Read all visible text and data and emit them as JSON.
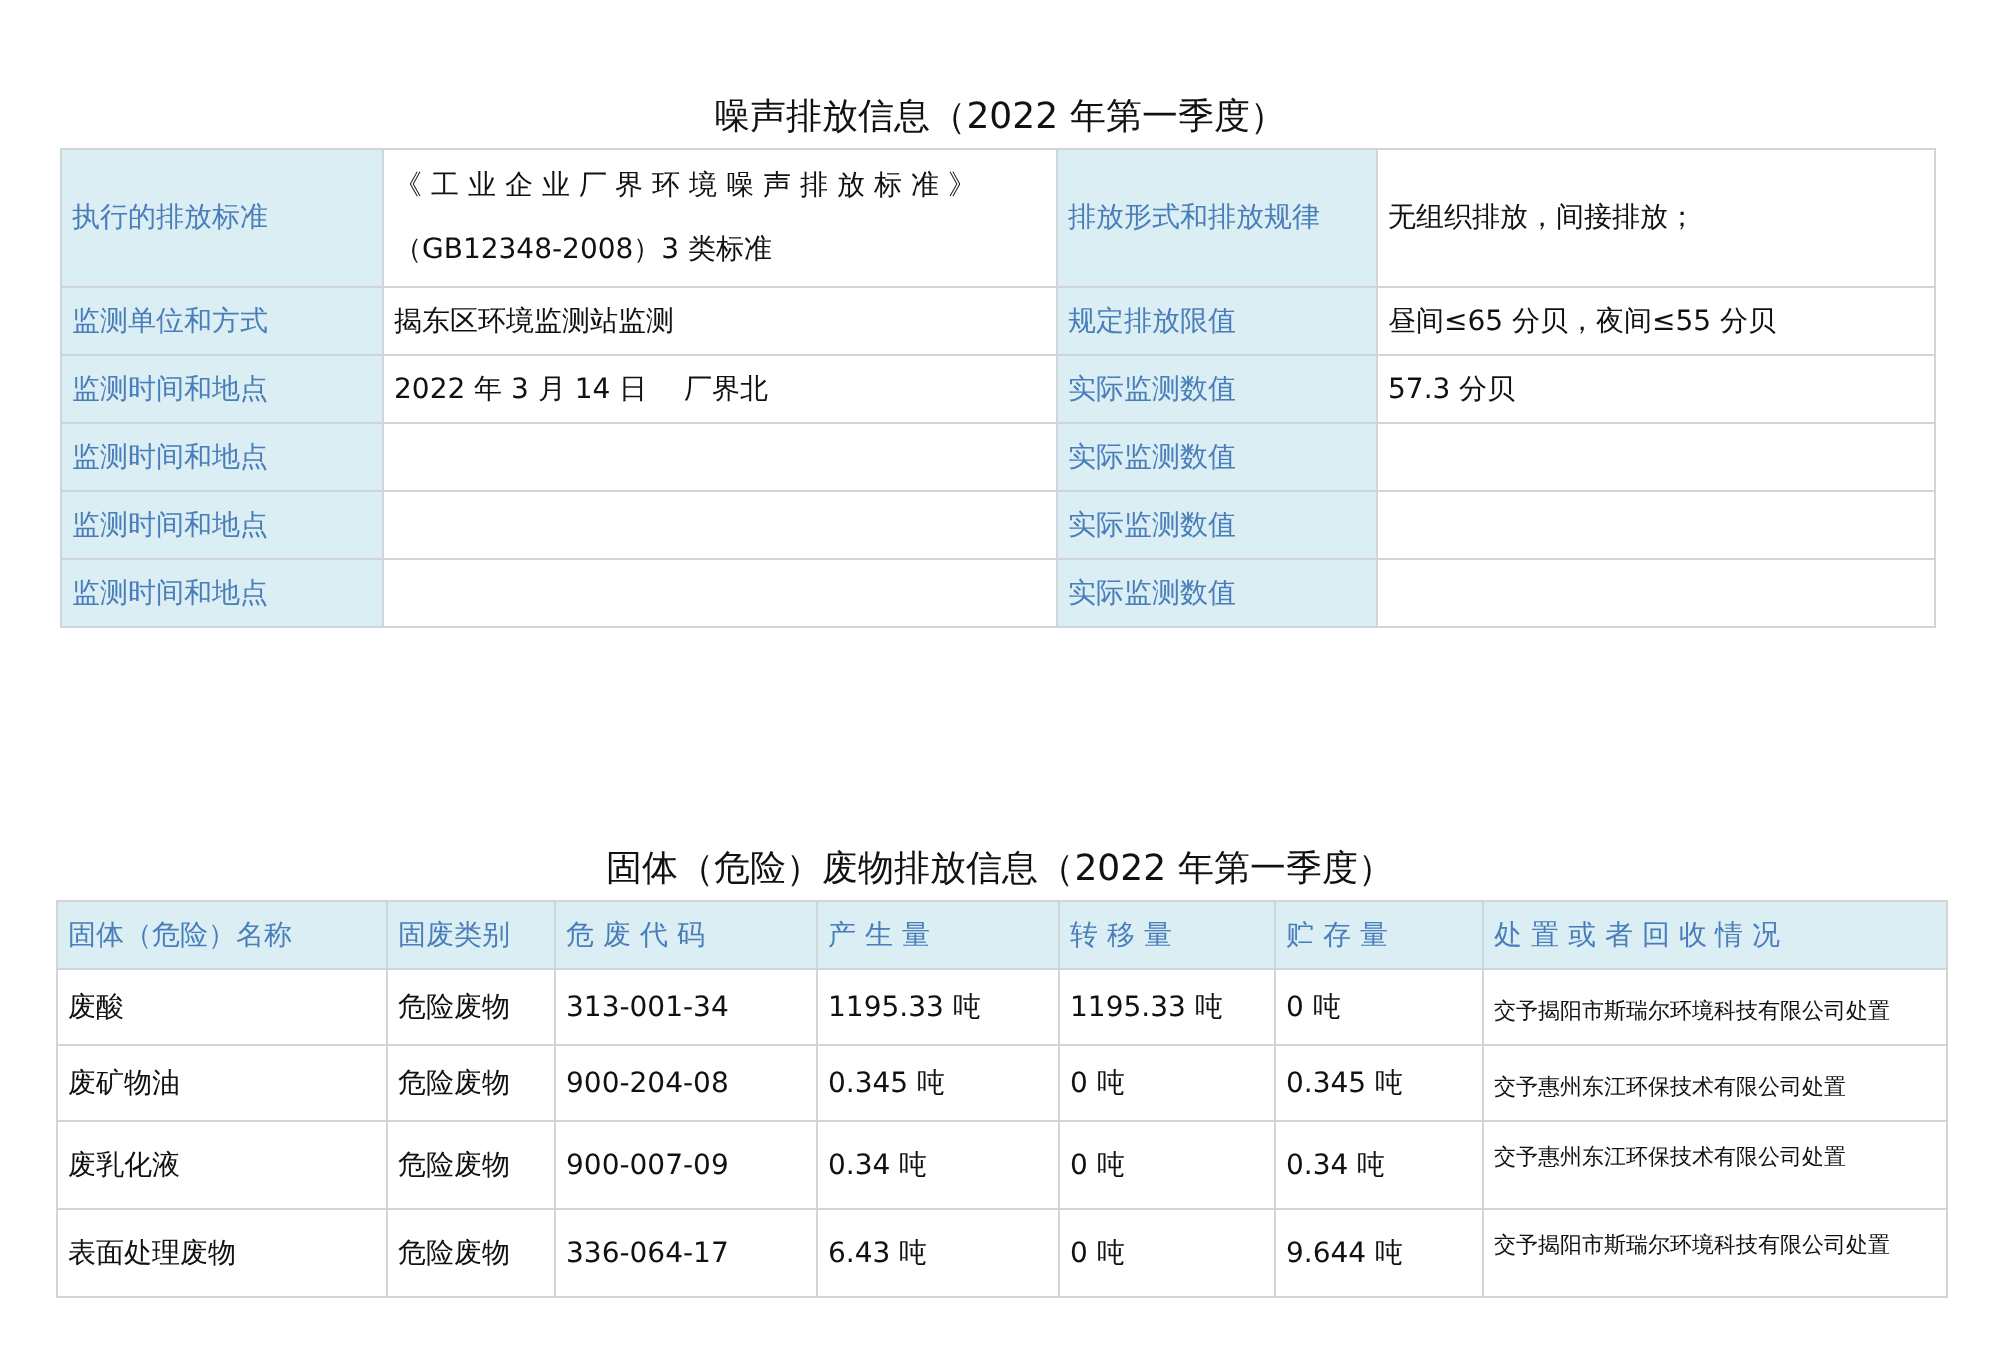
{
  "noise": {
    "title": "噪声排放信息（2022 年第一季度）",
    "rows": [
      {
        "label": "执行的排放标准",
        "value": "《 工 业 企 业 厂 界 环 境 噪 声 排 放 标 准 》（GB12348-2008）3 类标准",
        "label_2": "排放形式和排放规律",
        "value_2": "无组织排放，间接排放；"
      },
      {
        "label": "监测单位和方式",
        "value": "揭东区环境监测站监测",
        "label_2": "规定排放限值",
        "value_2": "昼间≤65 分贝，夜间≤55 分贝"
      },
      {
        "label": "监测时间和地点",
        "value": "2022 年 3 月 14 日　 厂界北",
        "label_2": "实际监测数值",
        "value_2": "57.3 分贝"
      },
      {
        "label": "监测时间和地点",
        "label_2": "实际监测数值"
      },
      {
        "label": "监测时间和地点",
        "label_2": "实际监测数值"
      },
      {
        "label": "监测时间和地点",
        "label_2": "实际监测数值"
      }
    ]
  },
  "waste": {
    "title": "固体（危险）废物排放信息（2022 年第一季度）",
    "columns": [
      "固体（危险）名称",
      "固废类别",
      "危 废 代 码",
      "产 生 量",
      "转 移 量",
      "贮 存 量",
      "处 置 或 者 回 收 情 况"
    ],
    "rows": [
      [
        "废酸",
        "危险废物",
        "313-001-34",
        "1195.33 吨",
        "1195.33 吨",
        "0 吨",
        "交予揭阳市斯瑞尔环境科技有限公司处置"
      ],
      [
        "废矿物油",
        "危险废物",
        "900-204-08",
        "0.345 吨",
        "0 吨",
        "0.345 吨",
        "交予惠州东江环保技术有限公司处置"
      ],
      [
        "废乳化液",
        "危险废物",
        "900-007-09",
        "0.34 吨",
        "0 吨",
        "0.34 吨",
        "交予惠州东江环保技术有限公司处置"
      ],
      [
        "表面处理废物",
        "危险废物",
        "336-064-17",
        "6.43 吨",
        "0 吨",
        "9.644 吨",
        "交予揭阳市斯瑞尔环境科技有限公司处置"
      ]
    ]
  }
}
